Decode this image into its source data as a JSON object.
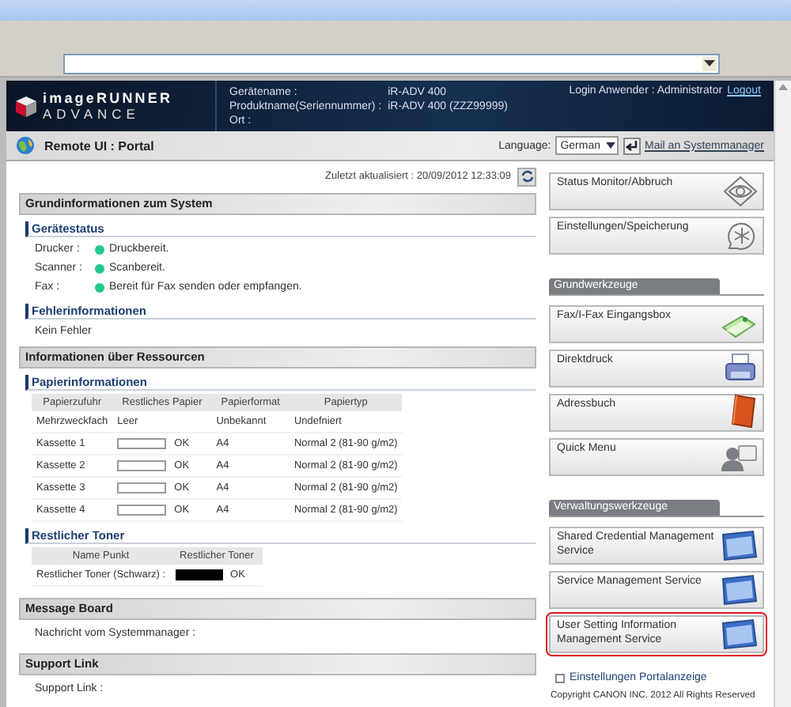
{
  "header": {
    "logo_top": "imageRUNNER",
    "logo_bottom": "ADVANCE",
    "device_fields": [
      {
        "label": "Gerätename :",
        "value": "iR-ADV 400"
      },
      {
        "label": "Produktname(Seriennummer) :",
        "value": "iR-ADV 400 (ZZZ99999)"
      },
      {
        "label": "Ort :"
      }
    ],
    "login": "Login Anwender : Administrator",
    "logout": "Logout"
  },
  "subbar": {
    "title": "Remote UI : Portal",
    "language_label": "Language:",
    "language": "German",
    "mail_link": "Mail an Systemmanager"
  },
  "last_updated": "Zuletzt aktualisiert : 20/09/2012 12:33:09",
  "system": {
    "title": "Grundinformationen zum System",
    "device_status": {
      "title": "Gerätestatus",
      "items": [
        {
          "label": "Drucker :",
          "color": "#22c98a",
          "text": "Druckbereit."
        },
        {
          "label": "Scanner :",
          "color": "#22c98a",
          "text": "Scanbereit."
        },
        {
          "label": "Fax :",
          "color": "#22c98a",
          "text": "Bereit für Fax senden oder empfangen."
        }
      ]
    },
    "errors": {
      "title": "Fehlerinformationen",
      "text": "Kein Fehler"
    }
  },
  "resources": {
    "title": "Informationen über Ressourcen",
    "paper": {
      "title": "Papierinformationen",
      "columns": [
        "Papierzufuhr",
        "Restliches Papier",
        "Papierformat",
        "Papiertyp"
      ],
      "rows": [
        {
          "source": "Mehrzweckfach",
          "remaining": "Leer",
          "size": "Unbekannt",
          "type": "Undefniert"
        },
        {
          "source": "Kassette 1",
          "level": 0,
          "remaining": "OK",
          "size": "A4",
          "type": "Normal 2 (81-90 g/m2)"
        },
        {
          "source": "Kassette 2",
          "level": 0,
          "remaining": "OK",
          "size": "A4",
          "type": "Normal 2 (81-90 g/m2)"
        },
        {
          "source": "Kassette 3",
          "level": 0,
          "remaining": "OK",
          "size": "A4",
          "type": "Normal 2 (81-90 g/m2)"
        },
        {
          "source": "Kassette 4",
          "level": 0,
          "remaining": "OK",
          "size": "A4",
          "type": "Normal 2 (81-90 g/m2)"
        }
      ]
    },
    "toner": {
      "title": "Restlicher Toner",
      "columns": [
        "Name Punkt",
        "Restlicher Toner"
      ],
      "rows": [
        {
          "name": "Restlicher Toner (Schwarz) :",
          "level": 1,
          "remaining": "OK"
        }
      ]
    }
  },
  "message_board": {
    "title": "Message Board",
    "text": "Nachricht vom Systemmanager :"
  },
  "support": {
    "title": "Support Link",
    "text": "Support Link :"
  },
  "tool_groups": [
    {
      "tools": [
        {
          "label": "Status Monitor/Abbruch",
          "highlighted": false
        },
        {
          "label": "Einstellungen/Speicherung",
          "highlighted": false
        }
      ]
    },
    {
      "title": "Grundwerkzeuge",
      "tools": [
        {
          "label": "Fax/I-Fax Eingangsbox",
          "highlighted": false
        },
        {
          "label": "Direktdruck",
          "highlighted": false
        },
        {
          "label": "Adressbuch",
          "highlighted": false
        },
        {
          "label": "Quick Menu",
          "highlighted": false
        }
      ]
    },
    {
      "title": "Verwaltungswerkzeuge",
      "tools": [
        {
          "label": "Shared Credential Management Service",
          "highlighted": false
        },
        {
          "label": "Service Management Service",
          "highlighted": false
        },
        {
          "label": "User Setting Information Management Service",
          "highlighted": true
        }
      ]
    }
  ],
  "portal_settings_link": "Einstellungen Portalanzeige",
  "copyright": "Copyright CANON INC. 2012 All Rights Reserved"
}
